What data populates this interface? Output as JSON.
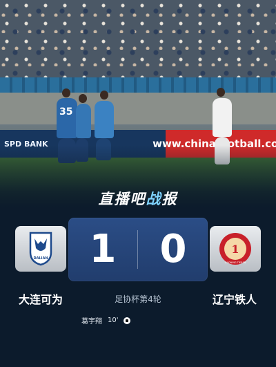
{
  "photo": {
    "ad_left_text": "SPD BANK",
    "ad_right_text": "www.chinafootball.com",
    "jersey_number": "35"
  },
  "title": {
    "part1": "直播吧",
    "part2": "战",
    "part3": "报"
  },
  "home_team": {
    "name": "大连可为",
    "logo_text": "DALIAN",
    "logo_color": "#1e4a8c",
    "score": "1"
  },
  "away_team": {
    "name": "辽宁铁人",
    "logo_text": "LIAONING TIEREN",
    "logo_color": "#c8202a",
    "score": "0"
  },
  "match": {
    "round": "足协杯第4轮"
  },
  "events": [
    {
      "player": "葛宇翔",
      "minute": "10'",
      "icon": "football-icon"
    }
  ]
}
